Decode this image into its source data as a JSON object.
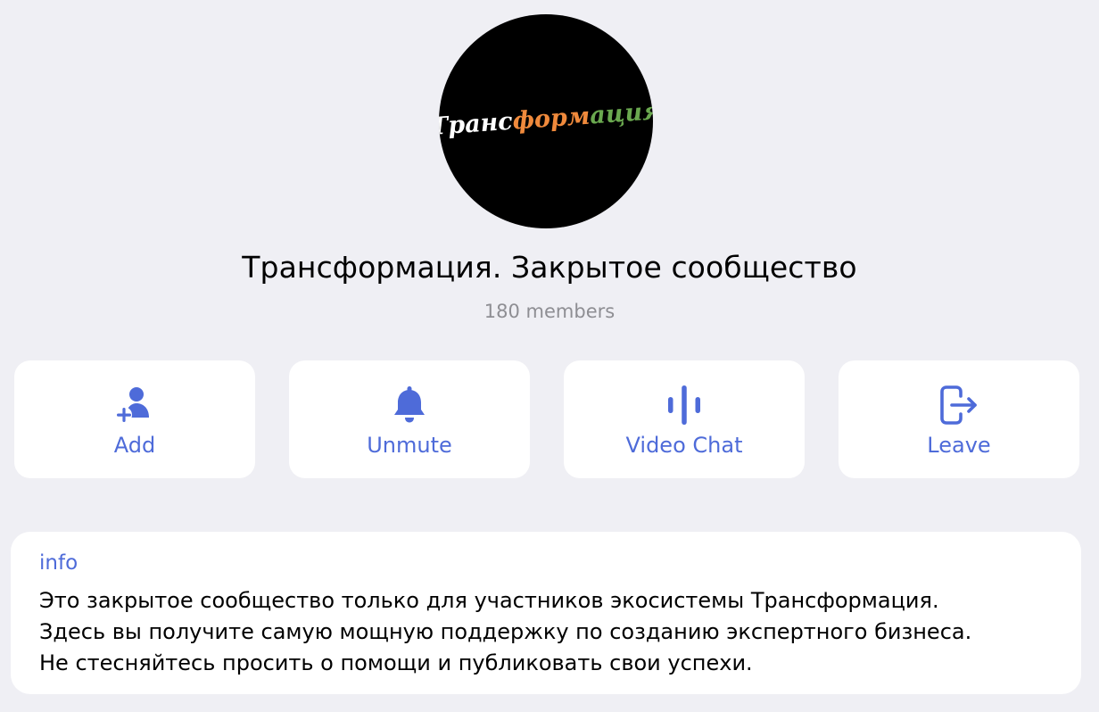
{
  "group": {
    "avatar_logo": {
      "part1": "Транс",
      "part2": "форм",
      "part3": "ация"
    },
    "title": "Трансформация. Закрытое сообщество",
    "members": "180 members"
  },
  "actions": [
    {
      "label": "Add",
      "icon": "add-user-icon"
    },
    {
      "label": "Unmute",
      "icon": "bell-icon"
    },
    {
      "label": "Video Chat",
      "icon": "voice-chat-icon"
    },
    {
      "label": "Leave",
      "icon": "leave-icon"
    }
  ],
  "info": {
    "label": "info",
    "lines": [
      "Это закрытое сообщество только для участников экосистемы Трансформация.",
      "Здесь вы получите самую мощную поддержку по созданию экспертного бизнеса.",
      "Не стесняйтесь просить о помощи и публиковать свои успехи."
    ]
  },
  "colors": {
    "accent": "#4e6bd9",
    "background": "#efeff4",
    "logo_white": "#ffffff",
    "logo_orange": "#f08a3c",
    "logo_green": "#6aa84f"
  }
}
